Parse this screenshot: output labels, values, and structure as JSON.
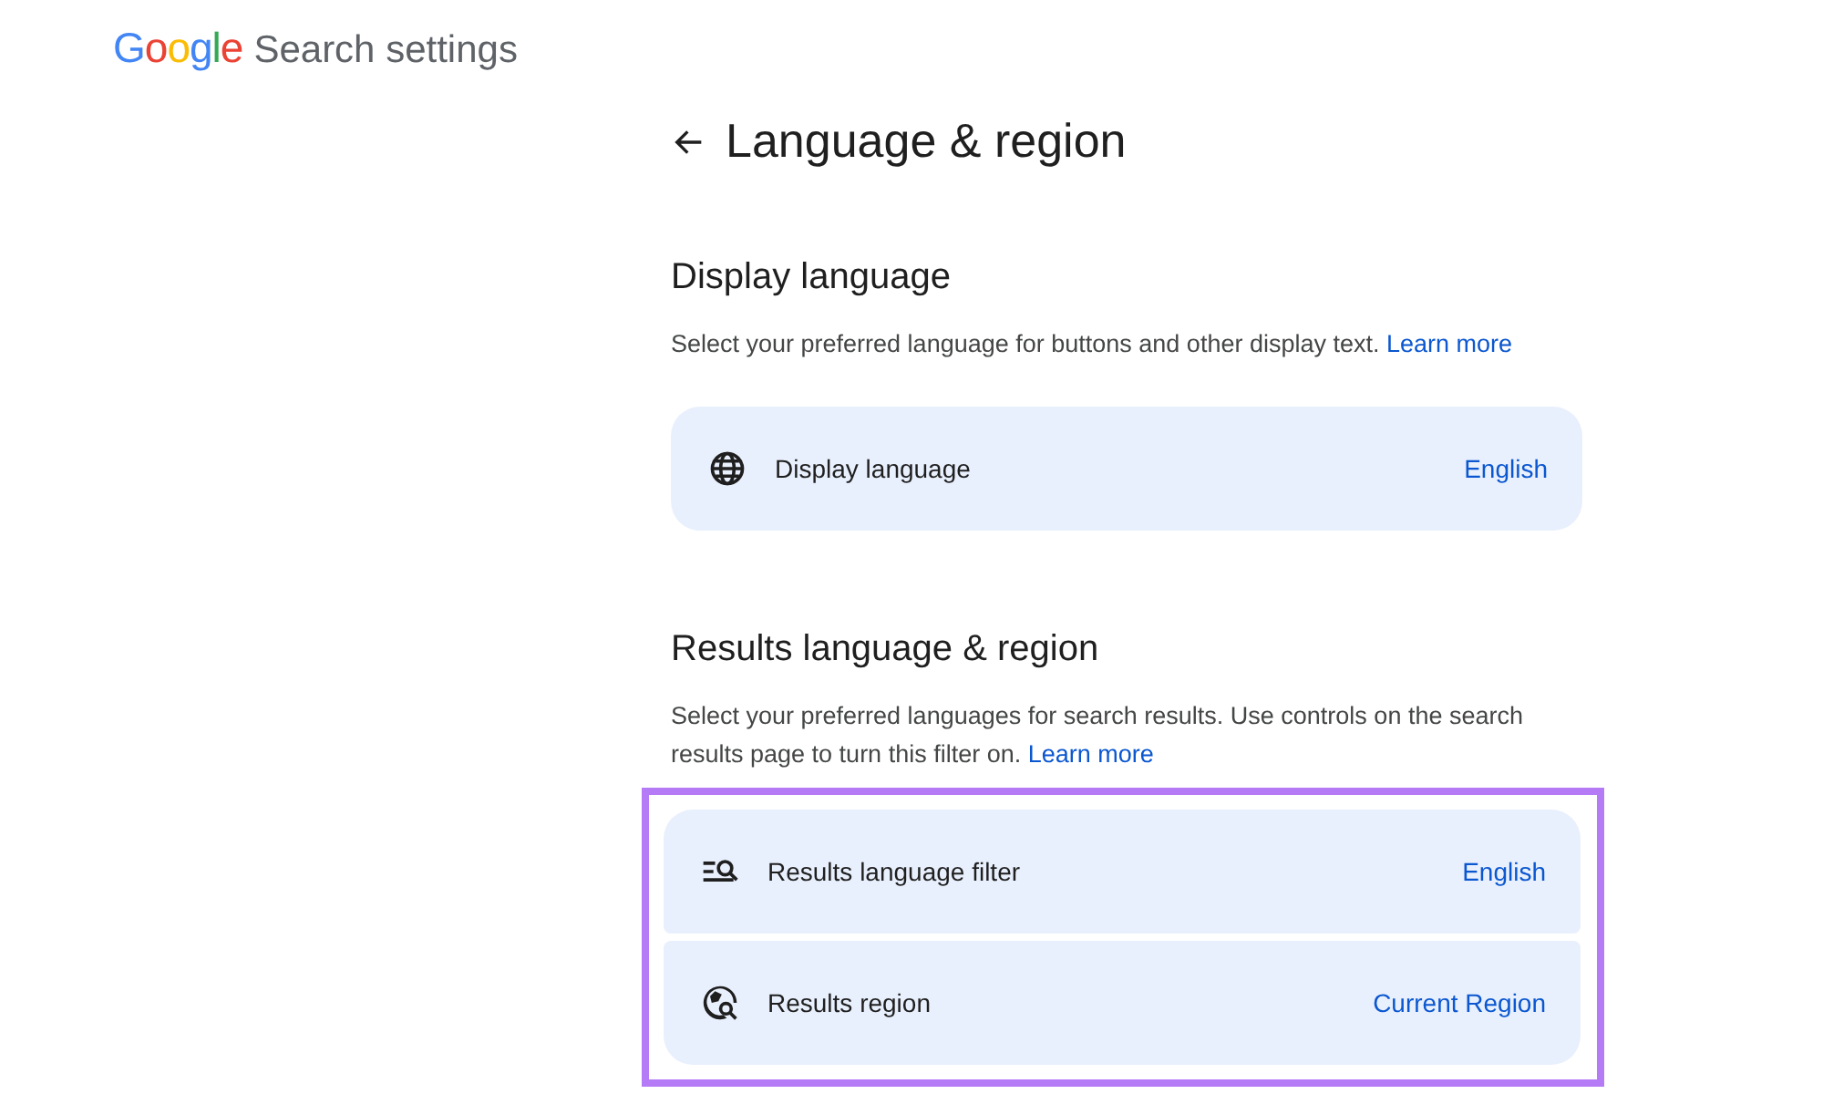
{
  "header": {
    "logo": "Google",
    "title": "Search settings"
  },
  "page": {
    "title": "Language & region"
  },
  "sections": [
    {
      "heading": "Display language",
      "description": "Select your preferred language for buttons and other display text.",
      "link": "Learn more",
      "highlighted": false,
      "items": [
        {
          "kind": "globe",
          "label": "Display language",
          "value": "English"
        }
      ]
    },
    {
      "heading": "Results language & region",
      "description": "Select your preferred languages for search results. Use controls on the search results page to turn this filter on.",
      "link": "Learn more",
      "highlighted": true,
      "items": [
        {
          "kind": "filter",
          "label": "Results language filter",
          "value": "English"
        },
        {
          "kind": "region",
          "label": "Results region",
          "value": "Current Region"
        }
      ]
    }
  ]
}
